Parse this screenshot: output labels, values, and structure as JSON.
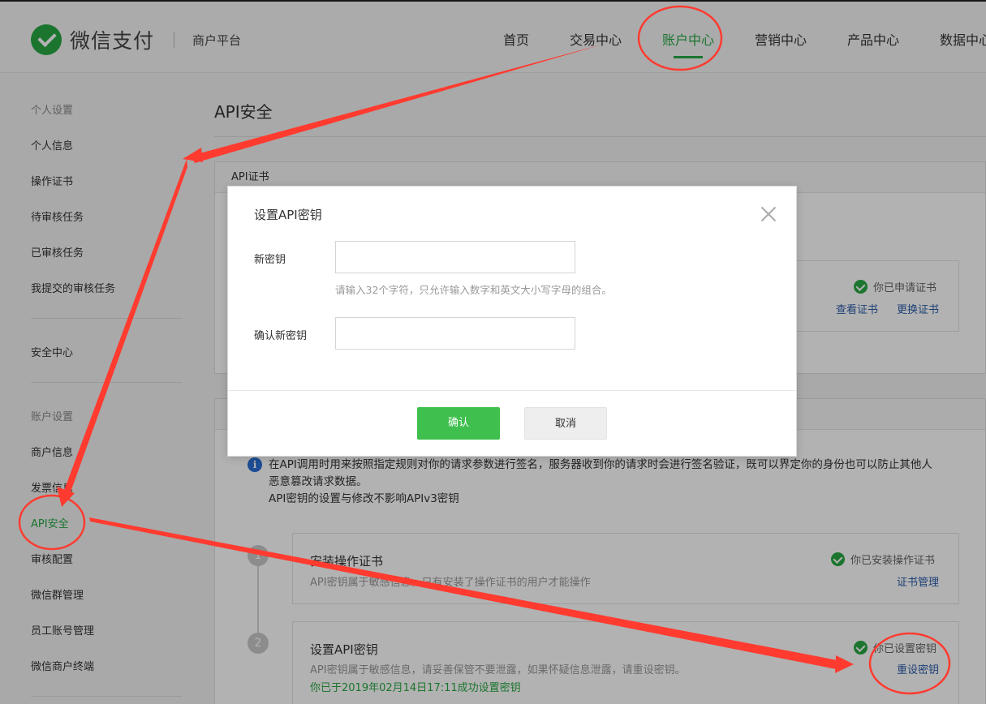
{
  "header": {
    "brand": "微信支付",
    "sub": "商户平台",
    "nav": [
      {
        "label": "首页"
      },
      {
        "label": "交易中心"
      },
      {
        "label": "账户中心"
      },
      {
        "label": "营销中心"
      },
      {
        "label": "产品中心"
      },
      {
        "label": "数据中心"
      }
    ]
  },
  "sidebar": {
    "group1_title": "个人设置",
    "group1": [
      {
        "label": "个人信息"
      },
      {
        "label": "操作证书"
      },
      {
        "label": "待审核任务"
      },
      {
        "label": "已审核任务"
      },
      {
        "label": "我提交的审核任务"
      }
    ],
    "security": "安全中心",
    "group2_title": "账户设置",
    "group2": [
      {
        "label": "商户信息"
      },
      {
        "label": "发票信息"
      },
      {
        "label": "API安全"
      },
      {
        "label": "审核配置"
      },
      {
        "label": "微信群管理"
      },
      {
        "label": "员工账号管理"
      },
      {
        "label": "微信商户终端"
      }
    ]
  },
  "main": {
    "title": "API安全",
    "cert_panel_title": "API证书",
    "cert_status": "你已申请证书",
    "cert_view": "查看证书",
    "cert_change": "更换证书",
    "desc_line1": "在API调用时用来按照指定规则对你的请求参数进行签名，服务器收到你的请求时会进行签名验证，既可以界定你的身份也可以防止其他人",
    "desc_line2": "恶意篡改请求数据。",
    "desc_line3": "API密钥的设置与修改不影响APIv3密钥",
    "steps": [
      {
        "num": "1",
        "title": "安装操作证书",
        "sub": "API密钥属于敏感信息，只有安装了操作证书的用户才能操作",
        "status": "你已安装操作证书",
        "action": "证书管理"
      },
      {
        "num": "2",
        "title": "设置API密钥",
        "sub": "API密钥属于敏感信息，请妥善保管不要泄露，如果怀疑信息泄露，请重设密钥。",
        "status": "你已设置密钥",
        "action": "重设密钥",
        "ok_note": "你已于2019年02月14日17:11成功设置密钥"
      }
    ]
  },
  "modal": {
    "title": "设置API密钥",
    "new_key_label": "新密钥",
    "new_key_value": "",
    "hint": "请输入32个字符，只允许输入数字和英文大小写字母的组合。",
    "confirm_key_label": "确认新密钥",
    "confirm_key_value": "",
    "ok_label": "确认",
    "cancel_label": "取消"
  },
  "colors": {
    "brand_green": "#27a843",
    "link_blue": "#2a5caa",
    "annotation_red": "#ff3b30"
  }
}
